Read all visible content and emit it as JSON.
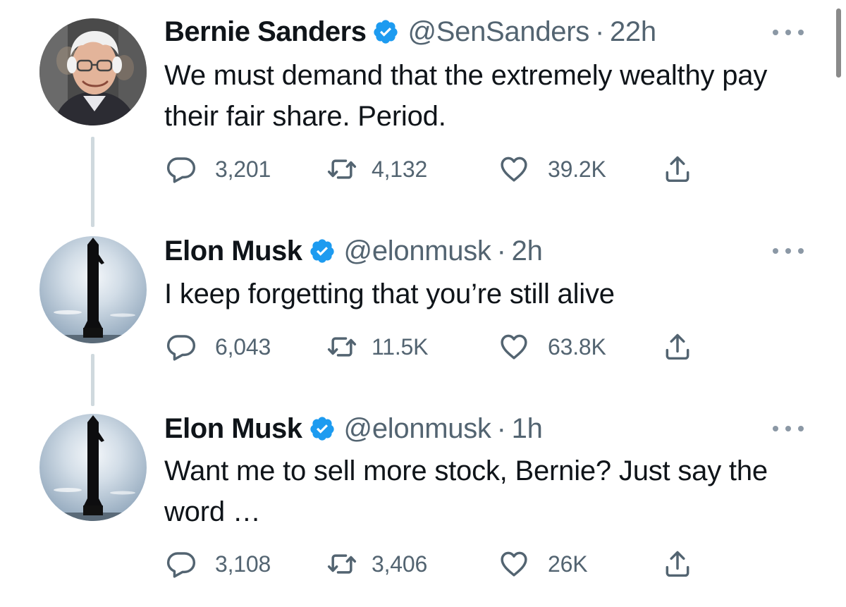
{
  "tweets": [
    {
      "name": "Bernie Sanders",
      "handle": "@SenSanders",
      "separator": "·",
      "time": "22h",
      "text": "We must demand that the extremely wealthy pay their fair share. Period.",
      "replies": "3,201",
      "retweets": "4,132",
      "likes": "39.2K",
      "avatar": "portrait-photo",
      "verified": true
    },
    {
      "name": "Elon Musk",
      "handle": "@elonmusk",
      "separator": "·",
      "time": "2h",
      "text": "I keep forgetting that you’re still alive",
      "replies": "6,043",
      "retweets": "11.5K",
      "likes": "63.8K",
      "avatar": "starship-photo",
      "verified": true
    },
    {
      "name": "Elon Musk",
      "handle": "@elonmusk",
      "separator": "·",
      "time": "1h",
      "text": "Want me to sell more stock, Bernie? Just say the word …",
      "replies": "3,108",
      "retweets": "3,406",
      "likes": "26K",
      "avatar": "starship-photo",
      "verified": true
    }
  ],
  "icons": {
    "reply": "speech-bubble-icon",
    "retweet": "retweet-arrows-icon",
    "like": "heart-icon",
    "share": "share-upload-icon",
    "more": "more-options-icon",
    "verified": "verified-badge-icon"
  },
  "colors": {
    "verified_blue": "#1d9bf0",
    "secondary_text": "#536471",
    "primary_text": "#0f1419",
    "thread_line": "#cfd9de"
  }
}
